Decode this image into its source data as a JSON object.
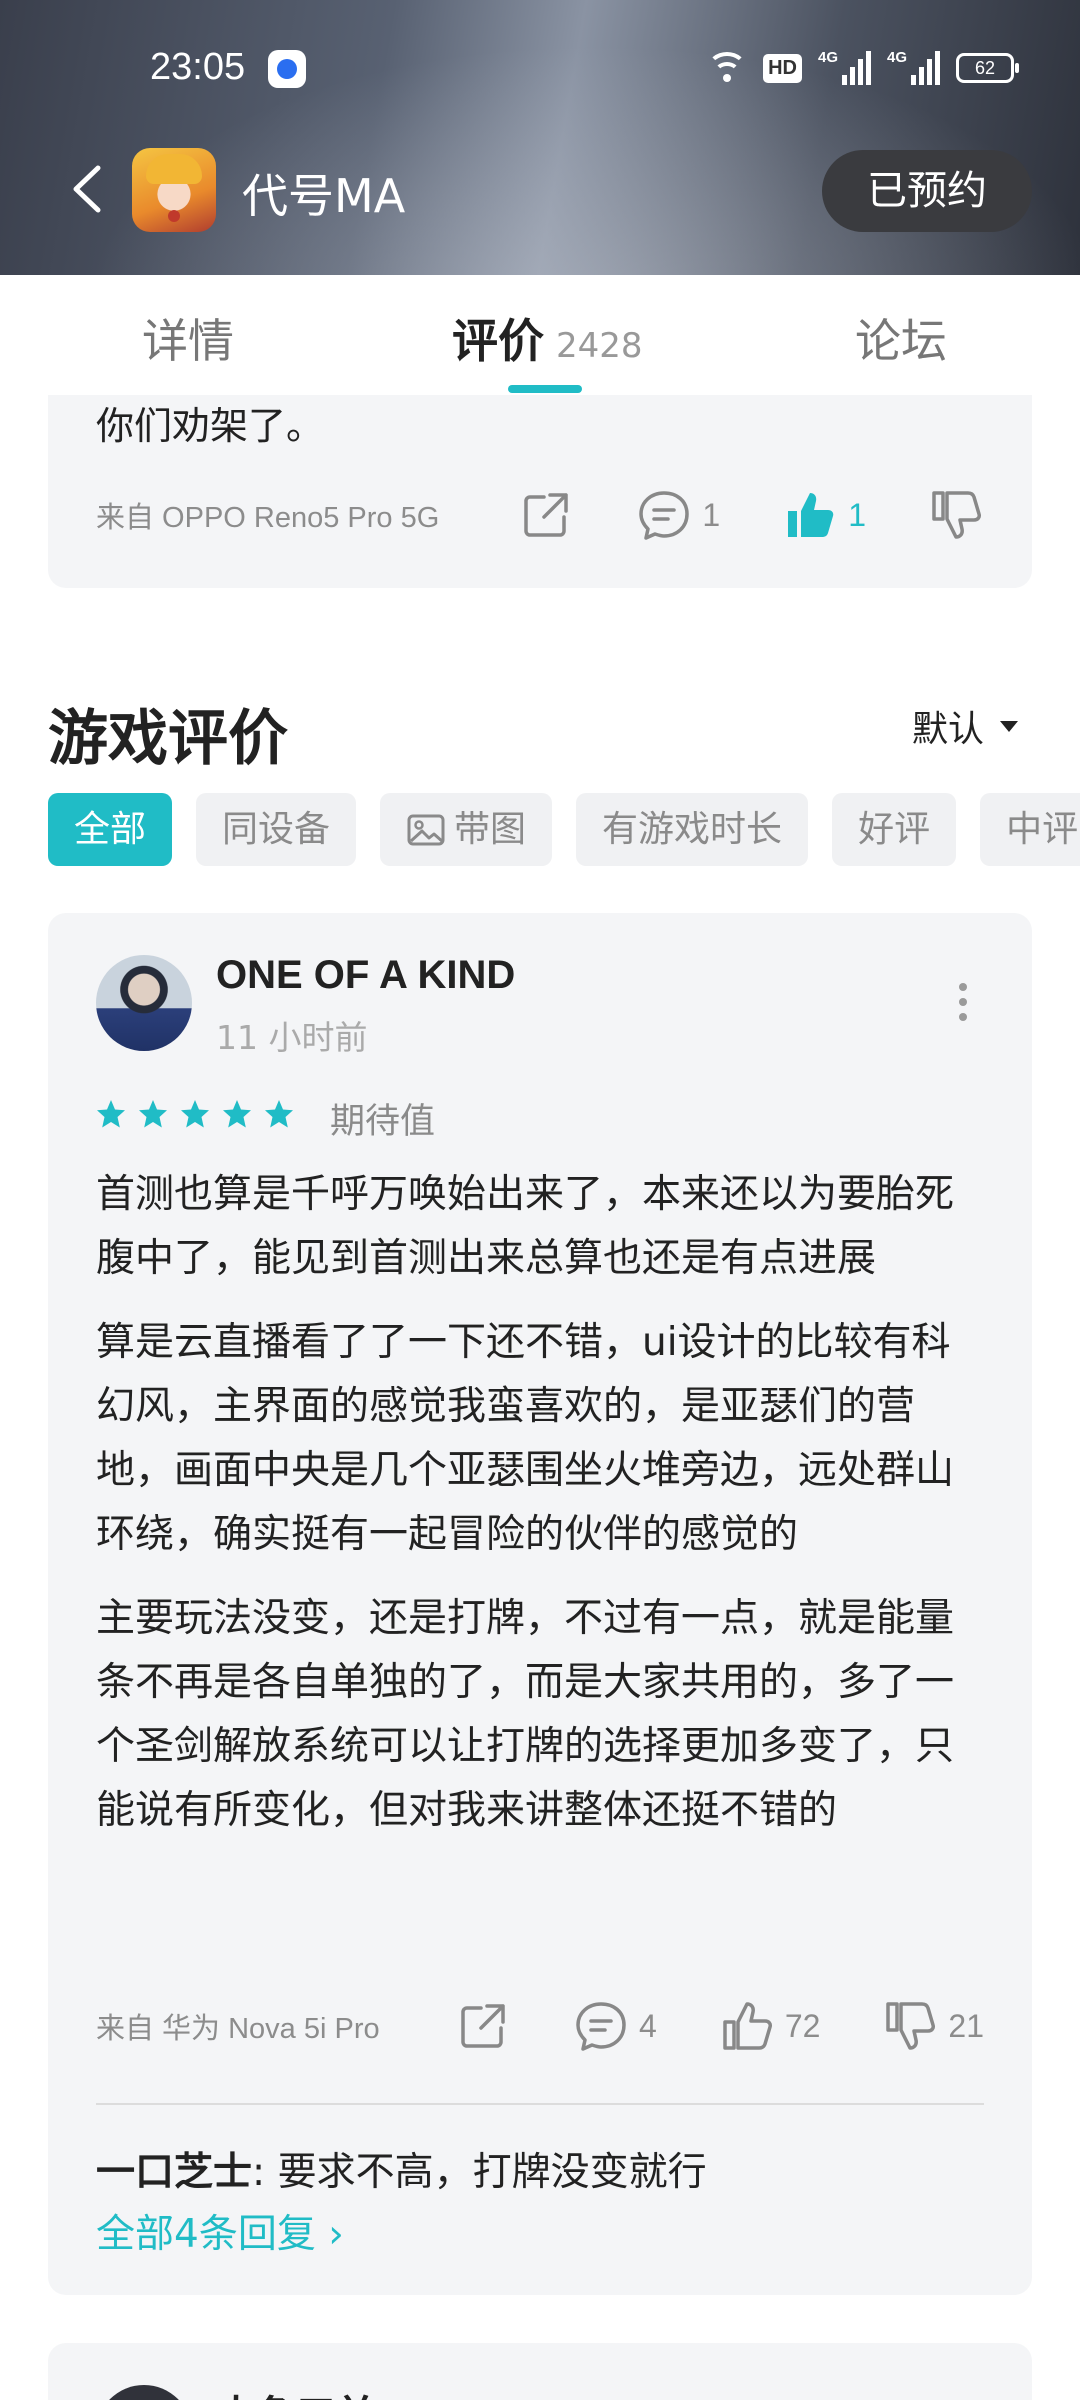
{
  "status_bar": {
    "time": "23:05",
    "network_type": "HD",
    "signal_1": "4G",
    "signal_2": "4G",
    "battery": "62"
  },
  "app_bar": {
    "title": "代号MA",
    "reserve_label": "已预约"
  },
  "tabs": [
    {
      "label": "详情"
    },
    {
      "label": "评价",
      "count": "2428"
    },
    {
      "label": "论坛"
    }
  ],
  "previous_review": {
    "tail_text": "你们劝架了。",
    "source": "来自 OPPO Reno5 Pro 5G",
    "comments": "1",
    "likes": "1"
  },
  "section": {
    "title": "游戏评价",
    "sort_label": "默认"
  },
  "filters": [
    "全部",
    "同设备",
    "带图",
    "有游戏时长",
    "好评",
    "中评"
  ],
  "review": {
    "user": "ONE OF A KIND",
    "time": "11 小时前",
    "rating": 5,
    "rating_label": "期待值",
    "paragraphs": [
      "首测也算是千呼万唤始出来了，本来还以为要胎死腹中了，能见到首测出来总算也还是有点进展",
      "算是云直播看了了一下还不错，ui设计的比较有科幻风，主界面的感觉我蛮喜欢的，是亚瑟们的营地，画面中央是几个亚瑟围坐火堆旁边，远处群山环绕，确实挺有一起冒险的伙伴的感觉的",
      "主要玩法没变，还是打牌，不过有一点，就是能量条不再是各自单独的了，而是大家共用的，多了一个圣剑解放系统可以让打牌的选择更加多变了，只能说有所变化，但对我来讲整体还挺不错的"
    ],
    "source": "来自 华为 Nova 5i Pro",
    "comments": "4",
    "likes": "72",
    "dislikes": "21",
    "reply_user": "一口芝士",
    "reply_sep": ": ",
    "reply_text": "要求不高，打牌没变就行",
    "all_replies": "全部4条回复 ›"
  },
  "next_review": {
    "user": "大鱼口并"
  },
  "colors": {
    "accent": "#20bcc6",
    "card_bg": "#f4f5f7",
    "muted_text": "#8c8c8c"
  }
}
